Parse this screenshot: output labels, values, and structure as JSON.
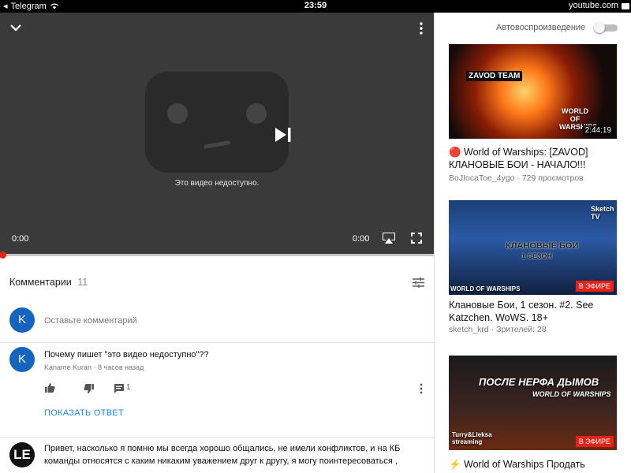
{
  "status_bar": {
    "app": "Telegram",
    "time": "23:59",
    "site": "youtube.com"
  },
  "player": {
    "message": "Это видео недоступно.",
    "current_time": "0:00",
    "duration": "0:00",
    "progress_percent": 0
  },
  "comments": {
    "header": "Комментарии",
    "count": "11",
    "add_placeholder": "Оставьте комментарий",
    "my_avatar": "K",
    "items": [
      {
        "avatar": "K",
        "text": "Почему пишет \"это видео недоступно\"??",
        "meta": "Kaname Kuran · 8 часов назад",
        "replies": "1",
        "show_reply": "ПОКАЗАТЬ ОТВЕТ"
      },
      {
        "avatar": "LE",
        "text": "Привет, насколько я помню мы всегда хорошо общались, не имели конфликтов, и на КБ команды относятся с каким никаким уважением друг к другу, я могу поинтересоваться ,"
      }
    ]
  },
  "sidebar": {
    "autoplay_label": "Автовоспроизведение",
    "autoplay_on": false,
    "videos": [
      {
        "title": "🔴 World of Warships: [ZAVOD] КЛАНОВЫЕ БОИ - НАЧАЛО!!!",
        "meta": "BoJIocaToe_4ygo · 729 просмотров",
        "badge": "2:44:19",
        "thumb_texts": [
          "ZAVOD TEAM",
          "WORLD OF WARSHIPS"
        ]
      },
      {
        "title": "Клановые Бои, 1 сезон. #2. See Katzchen. WoWS. 18+",
        "meta": "sketch_krd · Зрителей: 28",
        "badge": "В ЭФИРЕ",
        "thumb_texts": [
          "Sketch TV",
          "КЛАНОВЫЕ БОИ",
          "1 СЕЗОН",
          "WORLD OF WARSHIPS"
        ]
      },
      {
        "title": "⚡ World of Warships Продать",
        "meta": "",
        "badge": "В ЭФИРЕ",
        "thumb_texts": [
          "ПОСЛЕ НЕРФА ДЫМОВ",
          "WORLD OF WARSHIPS",
          "Turry&Lleksa streaming"
        ]
      }
    ]
  },
  "colors": {
    "accent_red": "#e62117",
    "link_blue": "#1e88e5",
    "avatar_blue": "#1565c0"
  }
}
